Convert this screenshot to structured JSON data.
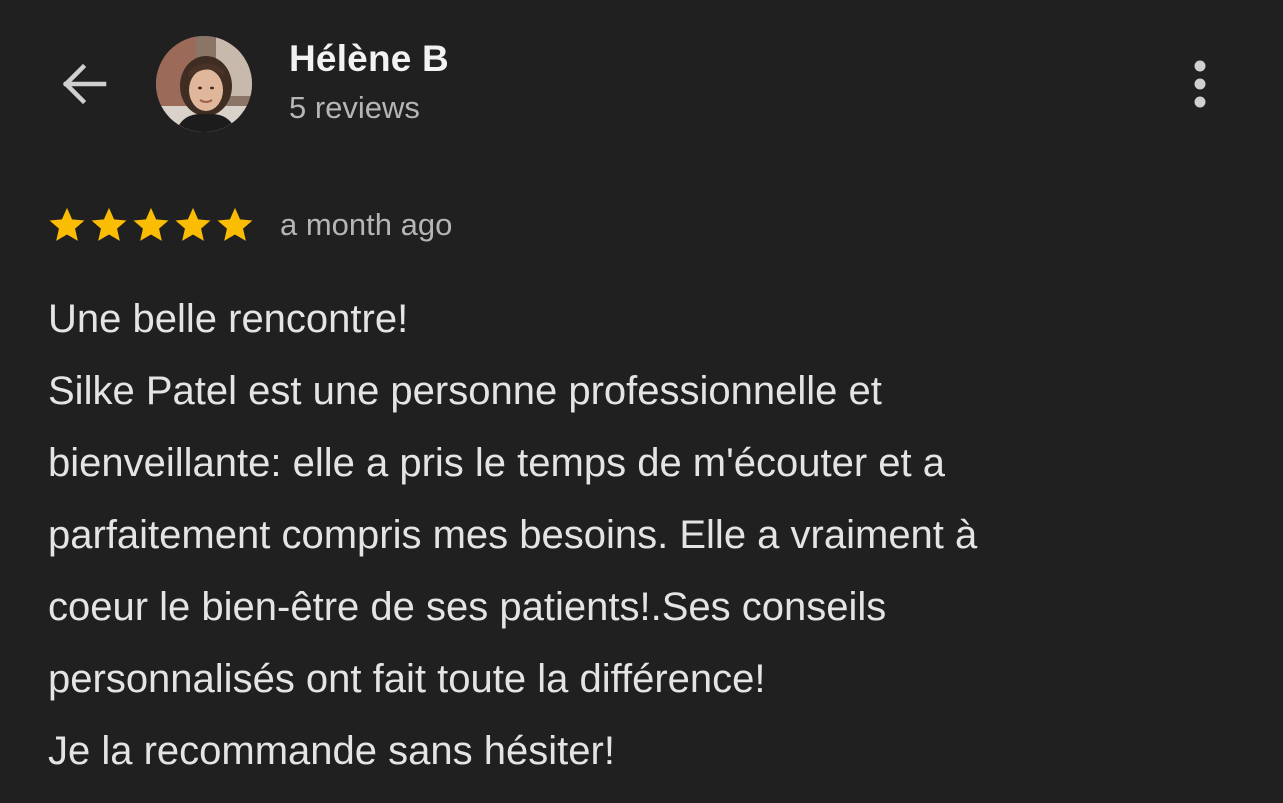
{
  "header": {
    "author_name": "Hélène B",
    "review_count": "5 reviews",
    "back_icon": "arrow-back-icon",
    "more_icon": "more-vert-icon"
  },
  "review": {
    "rating": 5,
    "rating_max": 5,
    "star_color": "#fbbc04",
    "date": "a month ago",
    "lines": [
      "Une belle rencontre!",
      "Silke Patel est une personne professionnelle et",
      "bienveillante: elle a pris le temps de m'écouter et a",
      "parfaitement compris mes besoins. Elle a vraiment à",
      "coeur le bien-être de ses patients!.Ses conseils",
      "personnalisés ont fait toute la différence!",
      "Je la recommande sans hésiter!"
    ]
  }
}
